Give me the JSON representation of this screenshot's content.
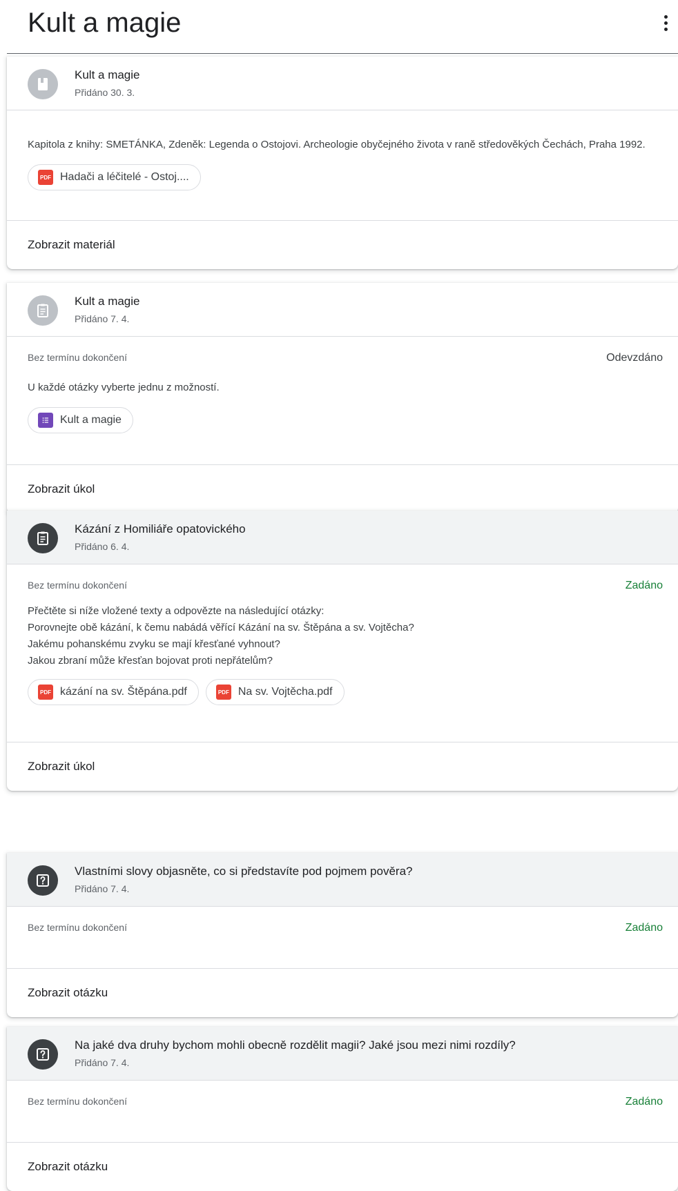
{
  "page": {
    "title": "Kult a magie",
    "more_icon": "more-vert-icon"
  },
  "colors": {
    "assigned": "#188038",
    "pdf": "#ea4335",
    "forms": "#7248b9"
  },
  "cards": [
    {
      "icon": "book-icon",
      "title": "Kult a magie",
      "date": "Přidáno 30. 3.",
      "description": "Kapitola z knihy: SMETÁNKA, Zdeněk: Legenda o Ostojovi. Archeologie obyčejného života v raně středověkých Čechách, Praha 1992.",
      "attachments": [
        {
          "type": "PDF",
          "name": "Hadači a léčitelé - Ostoj...."
        }
      ],
      "action": "Zobrazit materiál"
    },
    {
      "icon": "assignment-icon",
      "title": "Kult a magie",
      "date": "Přidáno 7. 4.",
      "due": "Bez termínu dokončení",
      "status": "Odevzdáno",
      "description": "U každé otázky vyberte jednu z možností.",
      "attachments": [
        {
          "type": "forms-icon",
          "name": "Kult a magie"
        }
      ],
      "action": "Zobrazit úkol"
    },
    {
      "icon": "assignment-icon",
      "title": "Kázání z Homiliáře opatovického",
      "date": "Přidáno 6. 4.",
      "due": "Bez termínu dokončení",
      "status": "Zadáno",
      "description_lines": [
        "Přečtěte si níže vložené texty a odpovězte na následující otázky:",
        "Porovnejte obě kázání, k čemu nabádá věřící Kázání na sv. Štěpána a sv. Vojtěcha?",
        "Jakému pohanskému zvyku se mají křesťané vyhnout?",
        "Jakou zbraní může křesťan bojovat proti nepřátelům?"
      ],
      "attachments": [
        {
          "type": "PDF",
          "name": "kázání na sv. Štěpána.pdf"
        },
        {
          "type": "PDF",
          "name": "Na sv. Vojtěcha.pdf"
        }
      ],
      "action": "Zobrazit úkol"
    },
    {
      "icon": "question-icon",
      "title": "Vlastními slovy objasněte, co si představíte pod pojmem pověra?",
      "date": "Přidáno 7. 4.",
      "due": "Bez termínu dokončení",
      "status": "Zadáno",
      "action": "Zobrazit otázku"
    },
    {
      "icon": "question-icon",
      "title": "Na jaké dva druhy bychom mohli obecně rozdělit magii? Jaké jsou mezi nimi rozdíly?",
      "date": "Přidáno 7. 4.",
      "due": "Bez termínu dokončení",
      "status": "Zadáno",
      "action": "Zobrazit otázku"
    }
  ]
}
